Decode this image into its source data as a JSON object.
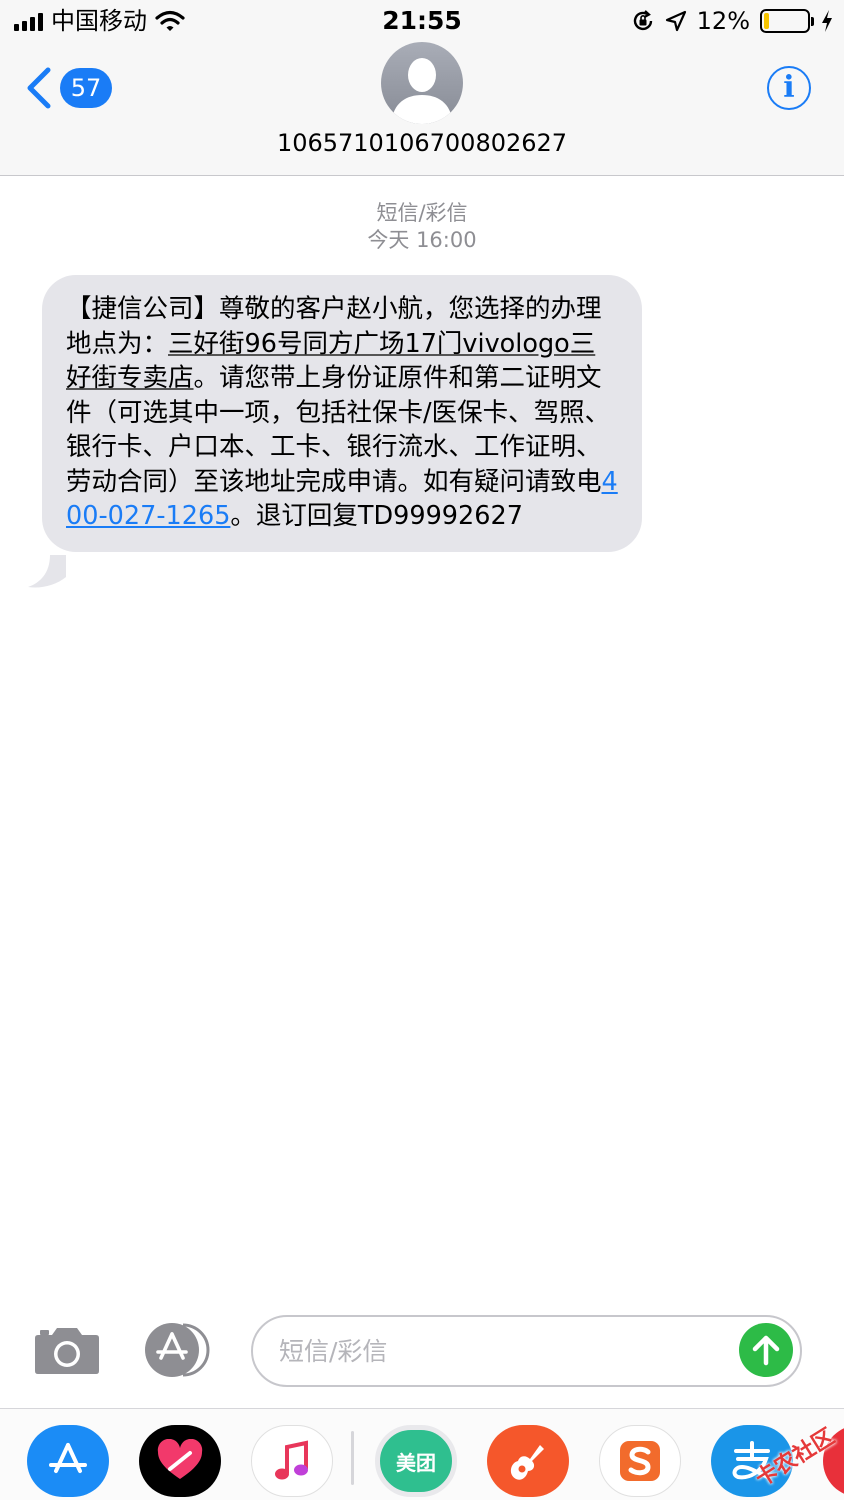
{
  "status_bar": {
    "carrier": "中国移动",
    "time": "21:55",
    "battery_percent": "12%",
    "battery_level": 0.12,
    "battery_color": "#f5c400"
  },
  "header": {
    "back_count": "57",
    "contact_number": "1065710106700802627",
    "info_icon_glyph": "i",
    "accent_color": "#1a7cf6"
  },
  "thread": {
    "service_label": "短信/彩信",
    "timestamp": "今天 16:00"
  },
  "message": {
    "text_part1": "【捷信公司】尊敬的客户赵小航，您选择的办理地点为：",
    "address_link": "三好街96号同方广场17门vivologo三好街专卖店",
    "text_part2": "。请您带上身份证原件和第二证明文件（可选其中一项，包括社保卡/医保卡、驾照、银行卡、户口本、工卡、银行流水、工作证明、劳动合同）至该地址完成申请。如有疑问请致电",
    "phone_link": "400-027-1265",
    "text_part3": "。退订回复TD99992627"
  },
  "composer": {
    "placeholder": "短信/彩信",
    "value": "",
    "send_color": "#2dbb47"
  },
  "app_drawer": {
    "apps": [
      {
        "icon": "app-store-icon",
        "color": "#1b8cf6"
      },
      {
        "icon": "digital-touch-icon",
        "color": "#000000"
      },
      {
        "icon": "music-icon",
        "color": "#ffffff"
      },
      {
        "icon": "meituan-icon",
        "label": "美团",
        "color": "#2fbf8f"
      },
      {
        "icon": "garageband-icon",
        "color": "#f5572b"
      },
      {
        "icon": "sogou-icon",
        "color": "#f26b2c"
      },
      {
        "icon": "alipay-icon",
        "color": "#1a95e8"
      },
      {
        "icon": "music-app-partial-icon",
        "color": "#e8303a"
      }
    ]
  },
  "watermark": {
    "text": "卡农社区"
  }
}
